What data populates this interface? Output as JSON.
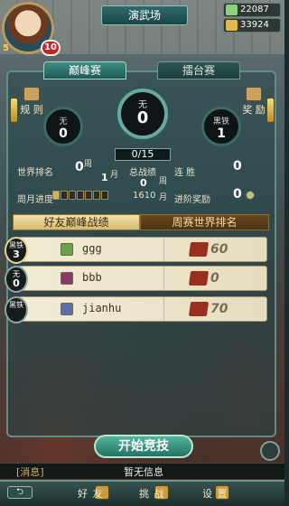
{
  "header": {
    "title": "演武场",
    "player_level_left": "5",
    "player_level_badge": "10",
    "resource_silver": "22087",
    "resource_gold": "33924"
  },
  "tabs": {
    "left": "巅峰赛",
    "right": "擂台赛"
  },
  "side_buttons": {
    "rules": "规 则",
    "rewards": "奖 励"
  },
  "center": {
    "left_ring": {
      "label": "无",
      "value": "0"
    },
    "main_ring": {
      "label": "无",
      "value": "0"
    },
    "right_ring": {
      "label": "黑铁",
      "value": "1"
    },
    "progress": "0/15"
  },
  "stats": {
    "world_rank_label": "世界排名",
    "world_rank_value": "0",
    "week_char": "周",
    "month_char": "月",
    "month_value": "1",
    "total_record_label": "总战绩",
    "total_record_value": "0",
    "total_record_sub": "1610",
    "streak_label": "连 胜",
    "streak_value": "0",
    "week_progress_label": "周月进度",
    "week_progress_filled": 1,
    "week_progress_total": 7,
    "advance_reward_label": "进阶奖励",
    "advance_reward_value": "0"
  },
  "ranking_tabs": {
    "friends": "好友巅峰战绩",
    "weekly": "周赛世界排名"
  },
  "rows": [
    {
      "rank_label": "黑铁",
      "rank_num": "3",
      "lv_icon": "lv",
      "lv_color": "#6aa04a",
      "name": "ggg",
      "score": "60",
      "active": true
    },
    {
      "rank_label": "无",
      "rank_num": "0",
      "lv_icon": "lv",
      "lv_color": "#8a3a6a",
      "name": "bbb",
      "score": "0",
      "active": false
    },
    {
      "rank_label": "黑铁",
      "rank_num": "",
      "lv_icon": "lv",
      "lv_color": "#5b6fa8",
      "name": "jianhu",
      "score": "70",
      "active": false
    }
  ],
  "start_button": "开始竞技",
  "message": {
    "tag": "[消息]",
    "text": "暂无信息"
  },
  "nav": {
    "friends": "好 友",
    "challenge": "挑 战",
    "settings": "设 置"
  }
}
